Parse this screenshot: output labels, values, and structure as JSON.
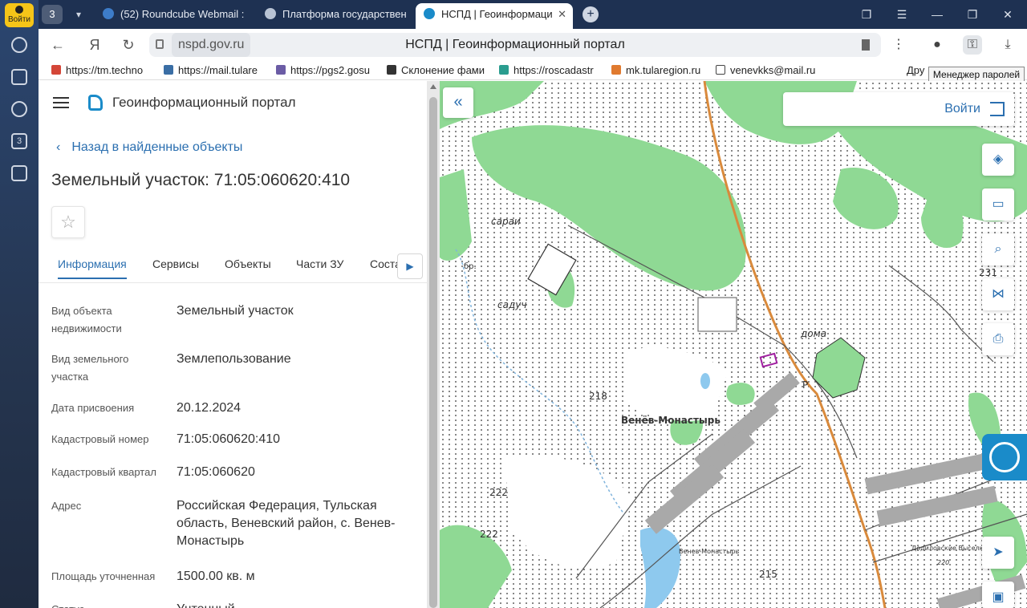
{
  "browser": {
    "login_label": "Войти",
    "tab_count": "3",
    "tabs": [
      {
        "label": "(52) Roundcube Webmail :",
        "icon": "roundcube-icon"
      },
      {
        "label": "Платформа государствен",
        "icon": "gov-eagle-icon"
      },
      {
        "label": "НСПД | Геоинформаци",
        "icon": "nspd-icon"
      }
    ],
    "address": {
      "domain": "nspd.gov.ru",
      "title": "НСПД | Геоинформационный портал"
    },
    "bookmarks": [
      {
        "label": "https://tm.techno",
        "icon": "gmail-icon"
      },
      {
        "label": "https://mail.tulare",
        "icon": "box-icon"
      },
      {
        "label": "https://pgs2.gosu",
        "icon": "gov-eagle-icon"
      },
      {
        "label": "Склонение фами",
        "icon": "glasses-icon"
      },
      {
        "label": "https://roscadastr",
        "icon": "rosreestr-icon"
      },
      {
        "label": "mk.tularegion.ru",
        "icon": "mk-icon"
      },
      {
        "label": "venevkks@mail.ru",
        "icon": "doc-icon"
      },
      {
        "label": "Дру",
        "icon": ""
      }
    ],
    "tooltip": "Менеджер паролей"
  },
  "panel": {
    "portal_title": "Геоинформационный портал",
    "back_label": "Назад в найденные объекты",
    "object_title": "Земельный участок: 71:05:060620:410",
    "tabs": [
      "Информация",
      "Сервисы",
      "Объекты",
      "Части ЗУ",
      "Соста"
    ],
    "properties": [
      {
        "key": "Вид объекта недвижимости",
        "value": "Земельный участок"
      },
      {
        "key": "Вид земельного участка",
        "value": "Землепользование"
      },
      {
        "key": "Дата присвоения",
        "value": "20.12.2024"
      },
      {
        "key": "Кадастровый номер",
        "value": "71:05:060620:410"
      },
      {
        "key": "Кадастровый квартал",
        "value": "71:05:060620"
      },
      {
        "key": "Адрес",
        "value": "Российская Федерация, Тульская область, Веневский район, с. Венев-Монастырь"
      },
      {
        "key": "Площадь уточненная",
        "value": "1500.00 кв. м"
      },
      {
        "key": "Статус",
        "value": "Учтенный"
      }
    ]
  },
  "map": {
    "login_label": "Войти",
    "labels": [
      "сараи",
      "садуч",
      "бр.",
      "218",
      "Венёв-Монастырь",
      "222",
      "222",
      "дома",
      "231",
      "215",
      "Венев-Монастырь",
      "Додиловские Выселки",
      "220",
      "Р"
    ]
  }
}
